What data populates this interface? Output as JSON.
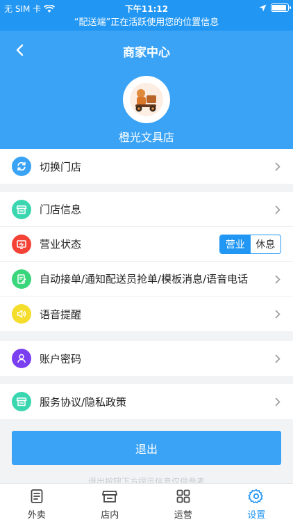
{
  "status_bar": {
    "carrier": "无 SIM 卡",
    "time": "下午11:12",
    "battery_level": 0.9
  },
  "location_banner": "“配送端”正在活跃使用您的位置信息",
  "header": {
    "title": "商家中心",
    "store_name": "橙光文具店"
  },
  "menu": {
    "switch_store": "切换门店",
    "store_info": "门店信息",
    "business_status": "营业状态",
    "status_open": "营业",
    "status_rest": "休息",
    "auto_order": "自动接单/通知配送员抢单/模板消息/语音电话",
    "voice_reminder": "语音提醒",
    "account_password": "账户密码",
    "service_agreement": "服务协议/隐私政策"
  },
  "logout_label": "退出",
  "faded_footer": "退出按钮下方提示信息仅供参考",
  "tabs": [
    {
      "label": "外卖",
      "icon": "document-icon"
    },
    {
      "label": "店内",
      "icon": "store-icon"
    },
    {
      "label": "运营",
      "icon": "grid-icon"
    },
    {
      "label": "设置",
      "icon": "gear-icon"
    }
  ],
  "colors": {
    "primary": "#2196f3",
    "header": "#3aa3f5"
  }
}
